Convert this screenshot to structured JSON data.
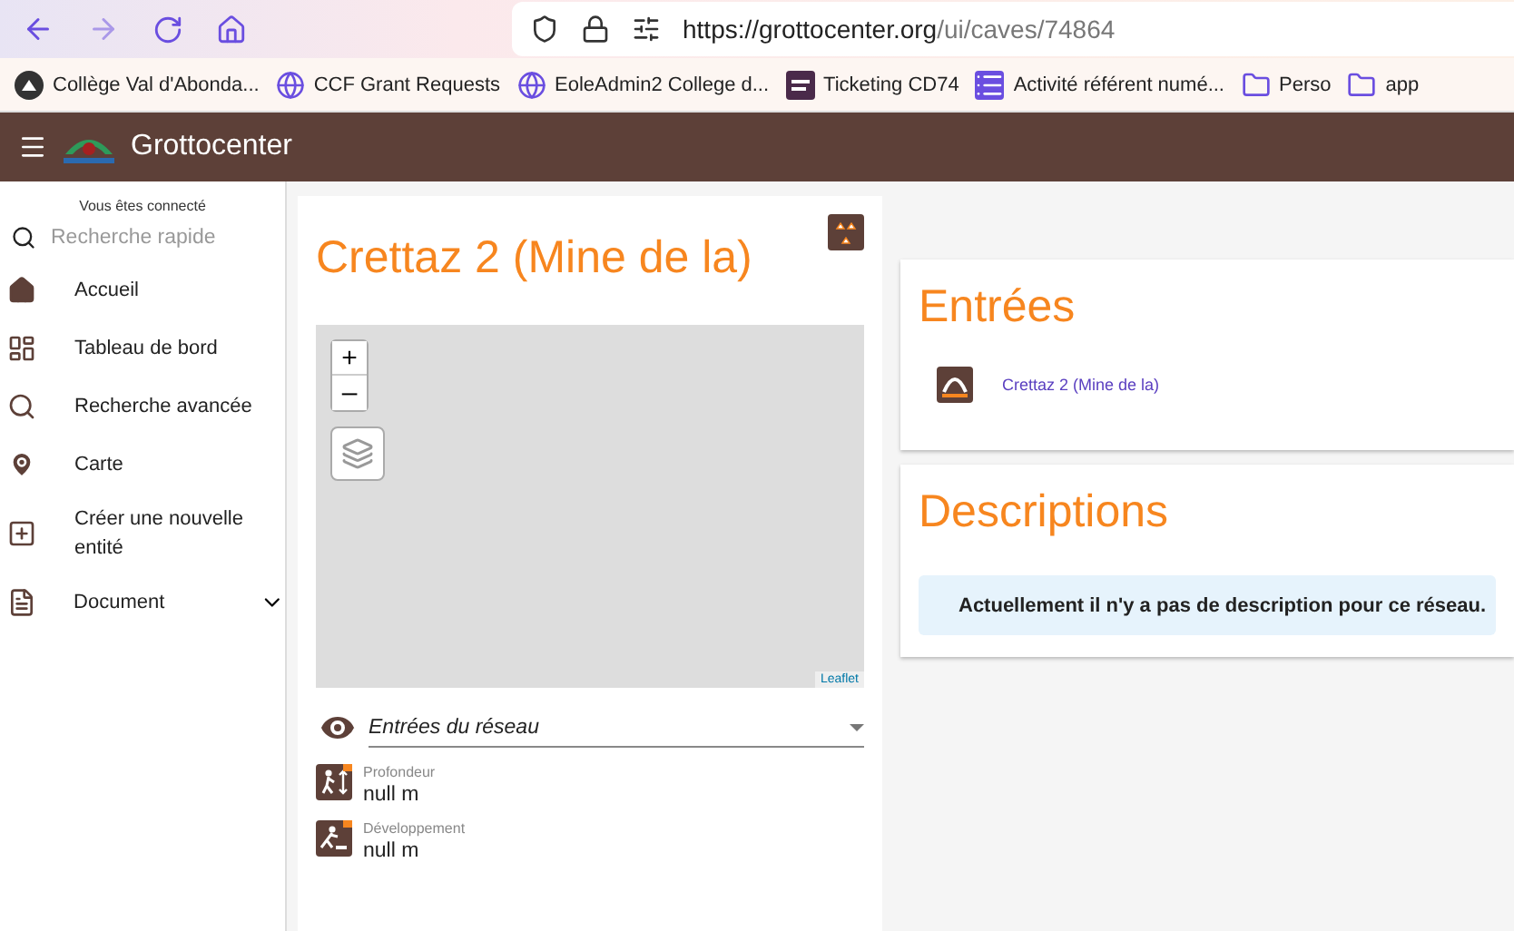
{
  "browser": {
    "url_host": "https://grottocenter.org",
    "url_path": "/ui/caves/74864",
    "bookmarks": [
      {
        "kind": "logo",
        "label": "Collège Val d'Abonda..."
      },
      {
        "kind": "globe",
        "label": "CCF Grant Requests"
      },
      {
        "kind": "globe",
        "label": "EoleAdmin2 College d..."
      },
      {
        "kind": "tile",
        "label": "Ticketing CD74"
      },
      {
        "kind": "list",
        "label": "Activité référent numé..."
      },
      {
        "kind": "folder",
        "label": "Perso"
      },
      {
        "kind": "folder",
        "label": "app"
      }
    ]
  },
  "app_bar": {
    "title": "Grottocenter"
  },
  "sidebar": {
    "status": "Vous êtes connecté",
    "search": {
      "placeholder": "Recherche rapide"
    },
    "items": [
      {
        "kind": "home",
        "label": "Accueil"
      },
      {
        "kind": "dashboard",
        "label": "Tableau de bord"
      },
      {
        "kind": "search",
        "label": "Recherche avancée"
      },
      {
        "kind": "pin",
        "label": "Carte"
      },
      {
        "kind": "add",
        "label": "Créer une nouvelle entité"
      },
      {
        "kind": "document",
        "label": "Document",
        "expanded": false
      }
    ]
  },
  "cave": {
    "title": "Crettaz 2 (Mine de la)",
    "map": {
      "zoom_in": "+",
      "zoom_out": "–",
      "attribution": "Leaflet"
    },
    "layer_select": {
      "value": "Entrées du réseau"
    },
    "properties": [
      {
        "kind": "depth",
        "label": "Profondeur",
        "value": "null m"
      },
      {
        "kind": "length",
        "label": "Développement",
        "value": "null m"
      }
    ]
  },
  "entrances": {
    "title": "Entrées",
    "items": [
      {
        "label": "Crettaz 2 (Mine de la)"
      }
    ]
  },
  "descriptions": {
    "title": "Descriptions",
    "notice": "Actuellement il n'y a pas de description pour ce réseau."
  }
}
